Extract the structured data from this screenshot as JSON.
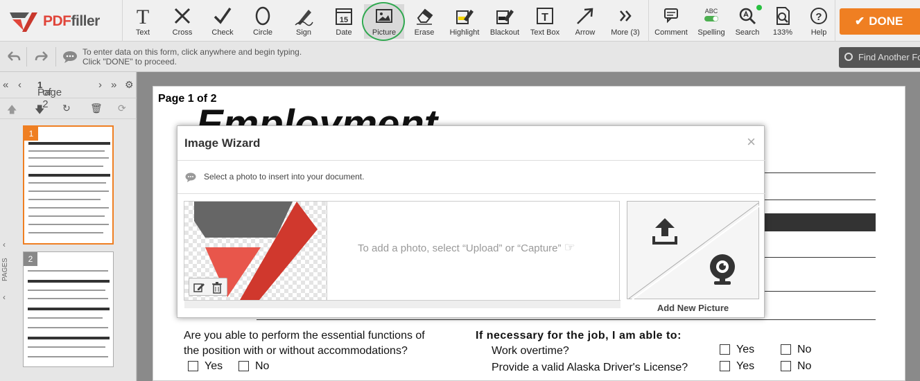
{
  "app": {
    "logo_text_a": "PDF",
    "logo_text_b": "filler"
  },
  "toolbar": {
    "tools": [
      {
        "label": "Text",
        "icon": "text-icon"
      },
      {
        "label": "Cross",
        "icon": "cross-icon"
      },
      {
        "label": "Check",
        "icon": "check-icon"
      },
      {
        "label": "Circle",
        "icon": "circle-icon"
      },
      {
        "label": "Sign",
        "icon": "sign-icon"
      },
      {
        "label": "Date",
        "icon": "date-icon"
      },
      {
        "label": "Picture",
        "icon": "picture-icon"
      },
      {
        "label": "Erase",
        "icon": "erase-icon"
      },
      {
        "label": "Highlight",
        "icon": "highlight-icon"
      },
      {
        "label": "Blackout",
        "icon": "blackout-icon"
      },
      {
        "label": "Text Box",
        "icon": "text-box-icon"
      },
      {
        "label": "Arrow",
        "icon": "arrow-icon"
      },
      {
        "label": "More (3)",
        "icon": "more-icon"
      },
      {
        "label": "Comment",
        "icon": "comment-icon"
      },
      {
        "label": "Spelling",
        "icon": "spelling-icon"
      },
      {
        "label": "Search",
        "icon": "search-icon"
      },
      {
        "label": "133%",
        "icon": "zoom-icon"
      },
      {
        "label": "Help",
        "icon": "help-icon"
      }
    ],
    "date_number": "15",
    "spelling_abc": "ABC",
    "done_label": "DONE"
  },
  "infobar": {
    "line1": "To enter data on this form, click anywhere and begin typing.",
    "line2": "Click \"DONE\" to proceed.",
    "find_label": "Find Another Fo"
  },
  "sidebar": {
    "page_label": "Page",
    "page_current": "1",
    "page_of": "of 2",
    "pages_tab": "PAGES",
    "thumbs": [
      {
        "num": "1",
        "selected": true
      },
      {
        "num": "2",
        "selected": false
      }
    ]
  },
  "document": {
    "page_header": "Page 1 of 2",
    "title_fragment": "Employment",
    "q1_line1": "Are you able to perform the essential functions of",
    "q1_line2": "the position with or without accommodations?",
    "q1_yes": "Yes",
    "q1_no": "No",
    "q2_heading": "If necessary for the job, I am able to:",
    "q2a": "Work overtime?",
    "q2a_yes": "Yes",
    "q2a_no": "No",
    "q2b": "Provide a valid Alaska Driver's License?",
    "q2b_yes": "Yes",
    "q2b_no": "No"
  },
  "modal": {
    "title": "Image Wizard",
    "close": "×",
    "subtitle": "Select a photo to insert into your document.",
    "hint": "To add a photo, select “Upload” or “Capture”",
    "add_new": "Add New Picture"
  },
  "colors": {
    "accent": "#ef7f22",
    "brand_red": "#e0453a",
    "active_ring": "#2fa84f"
  }
}
